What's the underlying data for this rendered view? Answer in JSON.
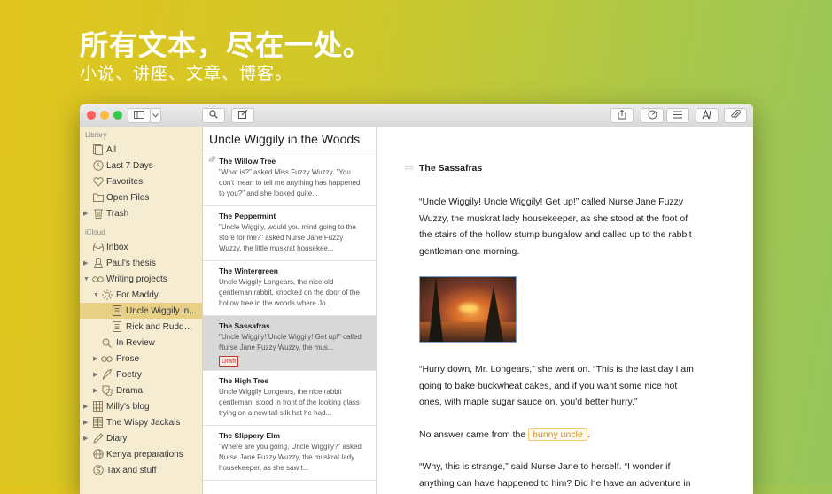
{
  "hero": {
    "title": "所有文本，尽在一处。",
    "subtitle": "小说、讲座、文章、博客。"
  },
  "colors": {
    "background_start": "#e2c51e",
    "background_end": "#97c65c",
    "sidebar_bg": "#f6ecd2",
    "sidebar_selected": "#e8cf86",
    "draft_badge": "#c0392b",
    "highlight": "#d4941a"
  },
  "toolbar": {
    "icons": [
      "sidebar-toggle-icon",
      "chevron-down-icon",
      "search-icon",
      "compose-icon",
      "share-icon",
      "goals-icon",
      "outline-icon",
      "font-icon",
      "attach-icon"
    ]
  },
  "sidebar": {
    "library_heading": "Library",
    "library_items": [
      {
        "label": "All",
        "icon": "documents-icon"
      },
      {
        "label": "Last 7 Days",
        "icon": "clock-icon"
      },
      {
        "label": "Favorites",
        "icon": "heart-icon"
      },
      {
        "label": "Open Files",
        "icon": "folder-icon"
      },
      {
        "label": "Trash",
        "icon": "trash-icon"
      }
    ],
    "icloud_heading": "iCloud",
    "icloud_items": [
      {
        "label": "Inbox",
        "icon": "inbox-icon"
      },
      {
        "label": "Paul's thesis",
        "icon": "graduation-icon"
      },
      {
        "label": "Writing projects",
        "icon": "glasses-icon"
      },
      {
        "label": "For Maddy",
        "icon": "sun-icon"
      },
      {
        "label": "Uncle Wiggily in...",
        "icon": "document-icon"
      },
      {
        "label": "Rick and Ruddy:...",
        "icon": "document-icon"
      },
      {
        "label": "In Review",
        "icon": "search-icon"
      },
      {
        "label": "Prose",
        "icon": "glasses-icon"
      },
      {
        "label": "Poetry",
        "icon": "quill-icon"
      },
      {
        "label": "Drama",
        "icon": "mask-icon"
      },
      {
        "label": "Milly's blog",
        "icon": "building-icon"
      },
      {
        "label": "The Wispy Jackals",
        "icon": "grid-icon"
      },
      {
        "label": "Diary",
        "icon": "pen-icon"
      },
      {
        "label": "Kenya preparations",
        "icon": "globe-icon"
      },
      {
        "label": "Tax and stuff",
        "icon": "money-icon"
      }
    ]
  },
  "notes": {
    "group_title": "Uncle Wiggily in the Woods",
    "items": [
      {
        "title": "The Willow Tree",
        "preview": "\"What is?\" asked Miss Fuzzy Wuzzy. \"You don't mean to tell me anything has happened to you?\" and she looked quite..."
      },
      {
        "title": "The Peppermint",
        "preview": "\"Uncle Wiggily, would you mind going to the store for me?\" asked Nurse Jane Fuzzy Wuzzy, the little muskrat housekee..."
      },
      {
        "title": "The Wintergreen",
        "preview": "Uncle Wiggily Longears, the nice old gentleman rabbit, knocked on the door of the hollow tree in the woods where Jo..."
      },
      {
        "title": "The Sassafras",
        "preview": "\"Uncle Wiggily! Uncle Wiggily! Get up!\" called Nurse Jane Fuzzy Wuzzy, the mus...",
        "badge": "Draft"
      },
      {
        "title": "The High Tree",
        "preview": "Uncle Wiggily Longears, the nice rabbit gentleman, stood in front of the looking glass trying on a new tall silk hat he had..."
      },
      {
        "title": "The Slippery Elm",
        "preview": "\"Where are you going, Uncle Wiggily?\" asked Nurse Jane Fuzzy Wuzzy, the muskrat lady housekeeper, as she saw t..."
      }
    ]
  },
  "editor": {
    "heading_marker": "##",
    "heading": "The Sassafras",
    "para1": "“Uncle Wiggily! Uncle Wiggily! Get up!” called Nurse Jane Fuzzy Wuzzy, the muskrat lady housekeeper, as she stood at the foot of the stairs of the hollow stump bungalow and called up to the rabbit gentleman one morning.",
    "para2": "“Hurry down, Mr. Longears,” she went on. “This is the last day I am going to bake buckwheat cakes, and if you want some nice hot ones, with maple sugar sauce on, you'd better hurry.”",
    "para3_before": "No answer came from the",
    "para3_highlight": "bunny uncle",
    "para3_after": ".",
    "para4": "“Why, this is strange,” said Nurse Jane to herself. “I wonder if anything can have happened to him? Did he have an adventure in"
  }
}
